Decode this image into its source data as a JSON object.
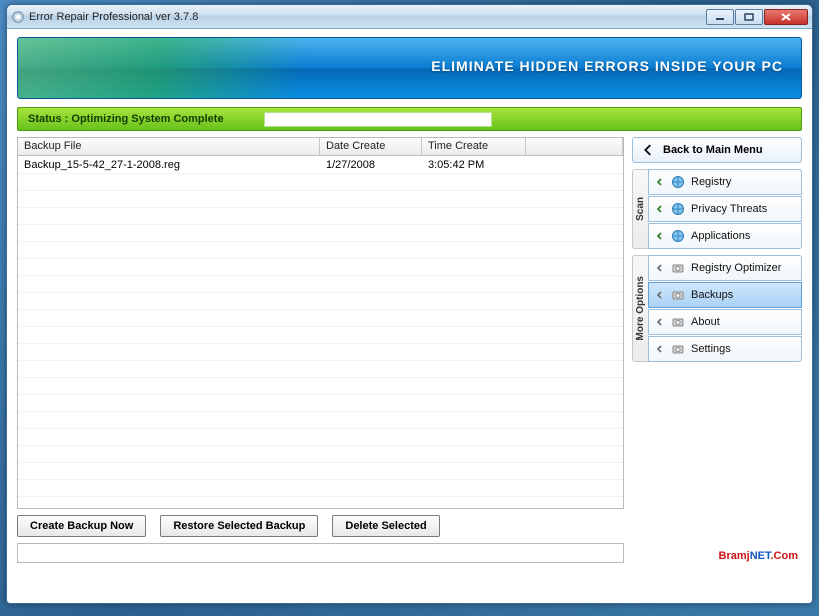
{
  "window": {
    "title": "Error Repair Professional ver 3.7.8"
  },
  "banner": {
    "slogan": "ELIMINATE HIDDEN ERRORS INSIDE YOUR PC"
  },
  "status": {
    "label": "Status : Optimizing System Complete"
  },
  "table": {
    "headers": {
      "file": "Backup File",
      "date": "Date Create",
      "time": "Time Create"
    },
    "rows": [
      {
        "file": "Backup_15-5-42_27-1-2008.reg",
        "date": "1/27/2008",
        "time": "3:05:42 PM"
      }
    ]
  },
  "buttons": {
    "create": "Create Backup Now",
    "restore": "Restore Selected Backup",
    "delete": "Delete Selected",
    "mainmenu": "Back to Main Menu"
  },
  "sidebar": {
    "scan_label": "Scan",
    "more_label": "More Options",
    "scan": [
      {
        "label": "Registry"
      },
      {
        "label": "Privacy Threats"
      },
      {
        "label": "Applications"
      }
    ],
    "more": [
      {
        "label": "Registry Optimizer"
      },
      {
        "label": "Backups",
        "selected": true
      },
      {
        "label": "About"
      },
      {
        "label": "Settings"
      }
    ]
  },
  "watermark": {
    "part1": "Bramj",
    "part2": "NET",
    "part3": ".Com"
  }
}
